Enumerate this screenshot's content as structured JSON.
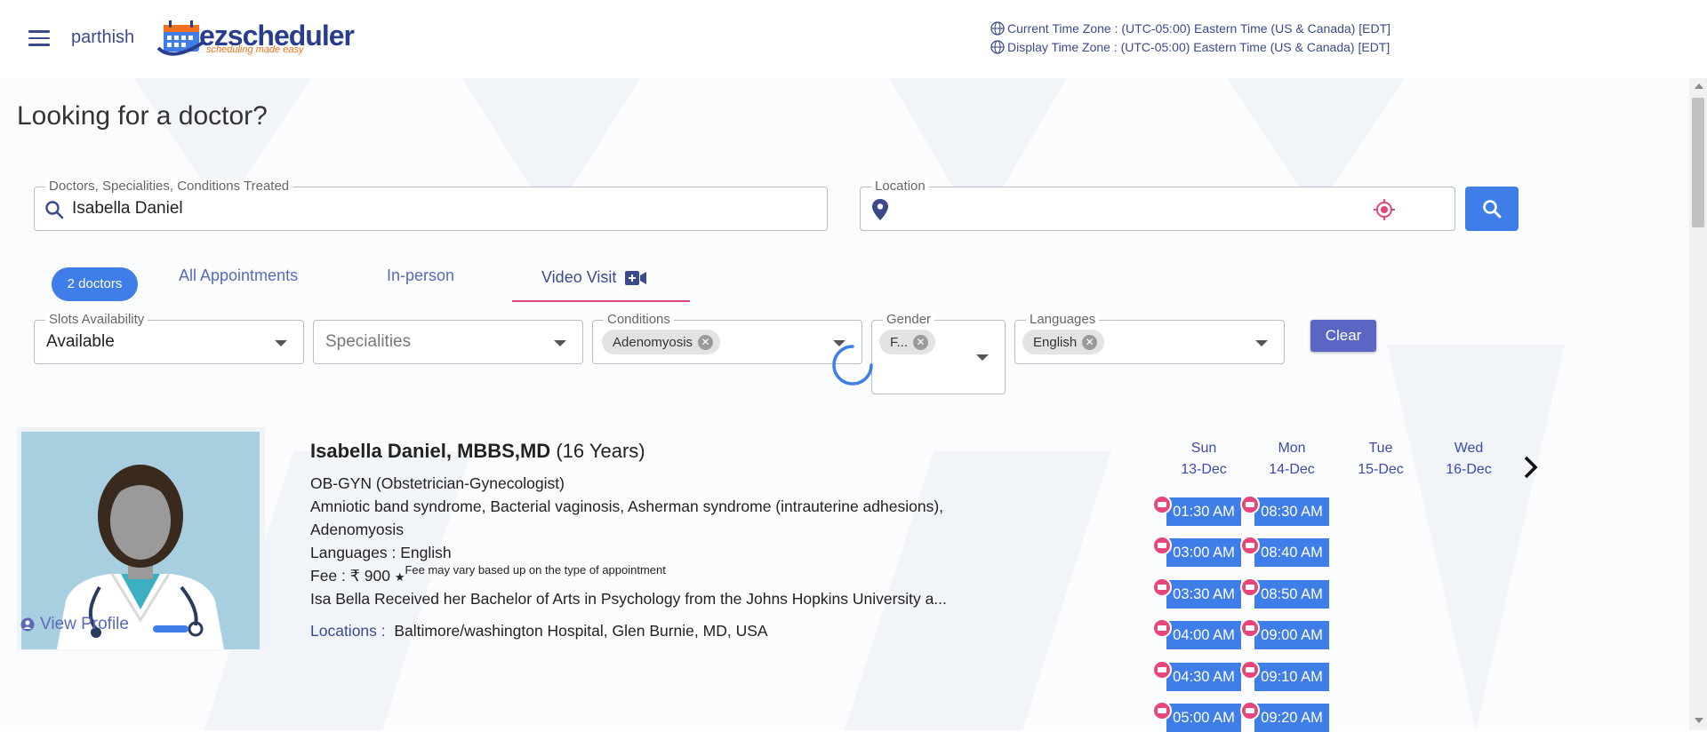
{
  "header": {
    "username": "parthish",
    "logo_name": "ezscheduler",
    "logo_tagline": "scheduling made easy",
    "current_tz": "Current Time Zone : (UTC-05:00) Eastern Time (US & Canada) [EDT]",
    "display_tz": "Display Time Zone : (UTC-05:00) Eastern Time (US & Canada) [EDT]"
  },
  "page": {
    "title": "Looking for a doctor?"
  },
  "search": {
    "label": "Doctors, Specialities, Conditions Treated",
    "value": "Isabella Daniel",
    "location_label": "Location",
    "location_value": ""
  },
  "tabs": {
    "count_badge": "2 doctors",
    "all": "All Appointments",
    "in_person": "In-person",
    "video": "Video Visit"
  },
  "filters": {
    "slots_label": "Slots Availability",
    "slots_value": "Available",
    "specialities_placeholder": "Specialities",
    "conditions_label": "Conditions",
    "conditions_chip": "Adenomyosis",
    "gender_label": "Gender",
    "gender_chip": "F...",
    "languages_label": "Languages",
    "languages_chip": "English",
    "clear": "Clear"
  },
  "doctor": {
    "name": "Isabella Daniel, MBBS,MD",
    "years": "(16 Years)",
    "specialty": "OB-GYN (Obstetrician-Gynecologist)",
    "conditions_line1": "Amniotic band syndrome, Bacterial vaginosis, Asherman syndrome (intrauterine adhesions),",
    "conditions_line2": "Adenomyosis",
    "languages": "Languages : English",
    "fee": "Fee : ₹ 900",
    "fee_star": "★",
    "fee_note": "Fee may vary based up on the type of appointment",
    "bio": "Isa Bella Received her Bachelor of Arts in Psychology from the Johns Hopkins University a...",
    "locations_label": "Locations :",
    "locations": "Baltimore/washington Hospital, Glen Burnie, MD, USA",
    "view_profile": "View Profile"
  },
  "schedule": {
    "days": [
      {
        "dow": "Sun",
        "date": "13-Dec"
      },
      {
        "dow": "Mon",
        "date": "14-Dec"
      },
      {
        "dow": "Tue",
        "date": "15-Dec"
      },
      {
        "dow": "Wed",
        "date": "16-Dec"
      }
    ],
    "sun_slots": [
      "01:30 AM",
      "03:00 AM",
      "03:30 AM",
      "04:00 AM",
      "04:30 AM",
      "05:00 AM"
    ],
    "mon_slots": [
      "08:30 AM",
      "08:40 AM",
      "08:50 AM",
      "09:00 AM",
      "09:10 AM",
      "09:20 AM"
    ]
  },
  "colors": {
    "primary": "#3f7ee8",
    "accent": "#e8457b",
    "nav_text": "#3c4a8c"
  }
}
